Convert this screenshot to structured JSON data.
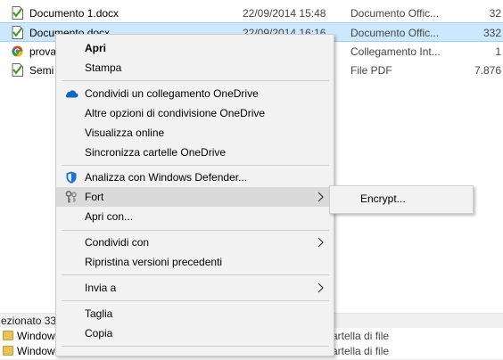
{
  "files": [
    {
      "name": "Documento 1.docx",
      "date": "22/09/2014 15:48",
      "type": "Documento Offic...",
      "size": "32"
    },
    {
      "name": "Documento.docx",
      "date": "22/09/2014 16:16",
      "type": "Documento Offic...",
      "size": "332"
    },
    {
      "name": "prova",
      "date": "",
      "type": "Collegamento Int...",
      "size": "1"
    },
    {
      "name": "Semi",
      "date": "",
      "type": "File PDF",
      "size": "7.876"
    }
  ],
  "status": {
    "text": "ezionato  33"
  },
  "bottom_rows": [
    {
      "name": "Windows.",
      "type": "artella di file"
    },
    {
      "name": "Windows.",
      "type": "artella di file"
    }
  ],
  "context_menu": {
    "open": "Apri",
    "print": "Stampa",
    "share_onedrive": "Condividi un collegamento OneDrive",
    "more_onedrive": "Altre opzioni di condivisione OneDrive",
    "view_online": "Visualizza online",
    "sync_onedrive": "Sincronizza cartelle OneDrive",
    "defender": "Analizza con Windows Defender...",
    "fort": "Fort",
    "open_with": "Apri con...",
    "share_with": "Condividi con",
    "restore": "Ripristina versioni precedenti",
    "send_to": "Invia a",
    "cut": "Taglia",
    "copy": "Copia"
  },
  "submenu": {
    "encrypt": "Encrypt..."
  },
  "colors": {
    "selection": "#cce8ff",
    "menu_bg": "#f2f2f2",
    "hover": "#dadada",
    "onedrive": "#0f65c8",
    "defender": "#1e6fd6"
  }
}
